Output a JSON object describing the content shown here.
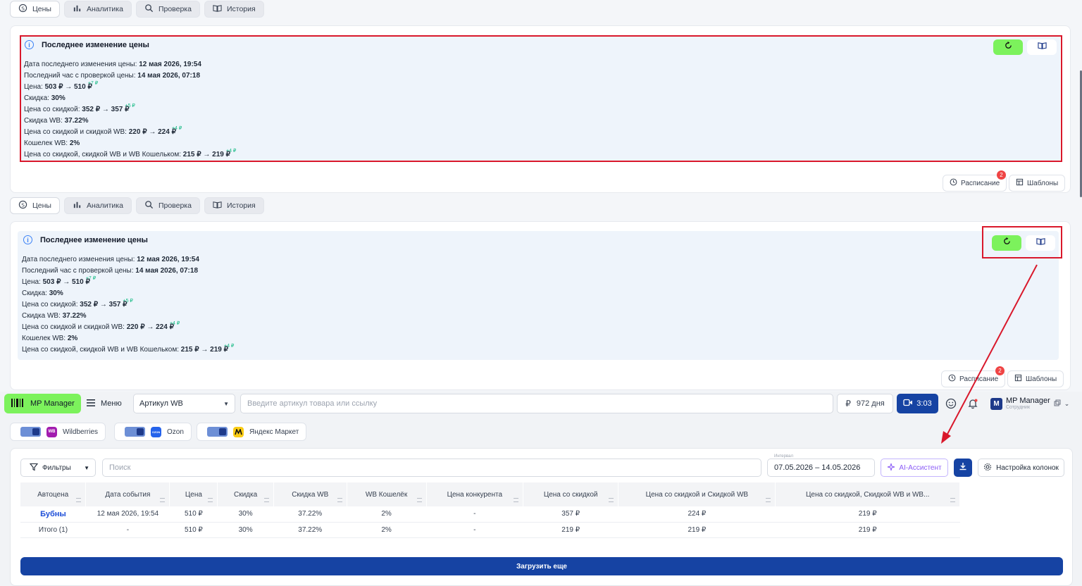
{
  "tabs": [
    "Цены",
    "Аналитика",
    "Проверка",
    "История"
  ],
  "info": {
    "title": "Последнее изменение цены",
    "lines": [
      {
        "label": "Дата последнего изменения цены: ",
        "value": "12 мая 2026, 19:54",
        "delta": ""
      },
      {
        "label": "Последний час с проверкой цены: ",
        "value": "14 мая 2026, 07:18",
        "delta": ""
      },
      {
        "label": "Цена: ",
        "value": "503 ₽ → 510 ₽",
        "delta": "+7 ₽"
      },
      {
        "label": "Скидка: ",
        "value": "30%",
        "delta": ""
      },
      {
        "label": "Цена со скидкой: ",
        "value": "352 ₽ → 357 ₽",
        "delta": "+5 ₽"
      },
      {
        "label": "Скидка WB: ",
        "value": "37.22%",
        "delta": ""
      },
      {
        "label": "Цена со скидкой и скидкой WB: ",
        "value": "220 ₽ → 224 ₽",
        "delta": "+4 ₽"
      },
      {
        "label": "Кошелек WB: ",
        "value": "2%",
        "delta": ""
      },
      {
        "label": "Цена со скидкой, скидкой WB и WB Кошельком: ",
        "value": "215 ₽ → 219 ₽",
        "delta": "+4 ₽"
      }
    ]
  },
  "actions": {
    "schedule": "Расписание",
    "templates": "Шаблоны",
    "schedule_badge": "2"
  },
  "topbar": {
    "logo": "MP Manager",
    "menu": "Меню",
    "select_value": "Артикул WB",
    "search_placeholder": "Введите артикул товара или ссылку",
    "days": "972 дня",
    "video_time": "3:03",
    "user_name": "MP Manager",
    "user_role": "Сотрудник",
    "avatar_letter": "M"
  },
  "marketplaces": [
    "Wildberries",
    "Ozon",
    "Яндекс Маркет"
  ],
  "marketplace_logos": {
    "wb": "WB",
    "ozon": "OZON"
  },
  "table_toolbar": {
    "filters": "Фильтры",
    "search_placeholder": "Поиск",
    "date_label": "Интервал",
    "date_range": "07.05.2026 – 14.05.2026",
    "ai": "AI-Ассистент",
    "columns": "Настройка колонок"
  },
  "table": {
    "headers": [
      "Автоцена",
      "Дата события",
      "Цена",
      "Скидка",
      "Скидка WB",
      "WB Кошелёк",
      "Цена конкурента",
      "Цена со скидкой",
      "Цена со скидкой и Скидкой WB",
      "Цена со скидкой, Скидкой WB и WB..."
    ],
    "rows": [
      [
        "Бубны",
        "12 мая 2026, 19:54",
        "510 ₽",
        "30%",
        "37.22%",
        "2%",
        "-",
        "357 ₽",
        "224 ₽",
        "219 ₽"
      ],
      [
        "Итого (1)",
        "-",
        "510 ₽",
        "30%",
        "37.22%",
        "2%",
        "-",
        "219 ₽",
        "219 ₽",
        "219 ₽"
      ]
    ]
  },
  "load_more": "Загрузить еще",
  "colors": {
    "accent_green": "#7cf25c",
    "primary_blue": "#1643a3",
    "highlight_red": "#d9182b",
    "info_bg": "#eef4fb"
  },
  "icons": [
    "price-icon",
    "chart-icon",
    "search-icon",
    "book-icon",
    "info-icon",
    "refresh-icon",
    "clock-icon",
    "template-icon",
    "menu-icon",
    "ruble-icon",
    "video-icon",
    "smile-icon",
    "bell-icon",
    "filter-icon",
    "sparkle-icon",
    "download-icon",
    "gear-icon"
  ]
}
